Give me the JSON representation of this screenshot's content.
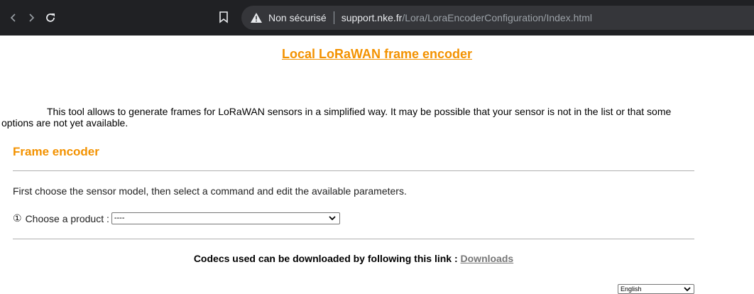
{
  "browser": {
    "security_label": "Non sécurisé",
    "url_host": "support.nke.fr",
    "url_path": "/Lora/LoraEncoderConfiguration/Index.html",
    "icons": {
      "back": "back-arrow-icon",
      "forward": "forward-arrow-icon",
      "reload": "reload-icon",
      "bookmark": "bookmark-icon",
      "warning": "warning-icon"
    }
  },
  "page": {
    "title": "Local LoRaWAN frame encoder",
    "intro": "This tool allows to generate frames for LoRaWAN sensors in a simplified way. It may be possible that your sensor is not in the list or that some options are not yet available.",
    "section_heading": "Frame encoder",
    "instructions": "First choose the sensor model, then select a command and edit the available parameters.",
    "product": {
      "step_marker": "①",
      "label": "Choose a product :",
      "selected": "----"
    },
    "codecs_text": "Codecs used can be downloaded by following this link : ",
    "downloads_link": "Downloads",
    "language": {
      "selected": "English"
    }
  },
  "colors": {
    "accent": "#f39200",
    "toolbar_bg": "#202124",
    "omnibox_bg": "#35363a"
  }
}
